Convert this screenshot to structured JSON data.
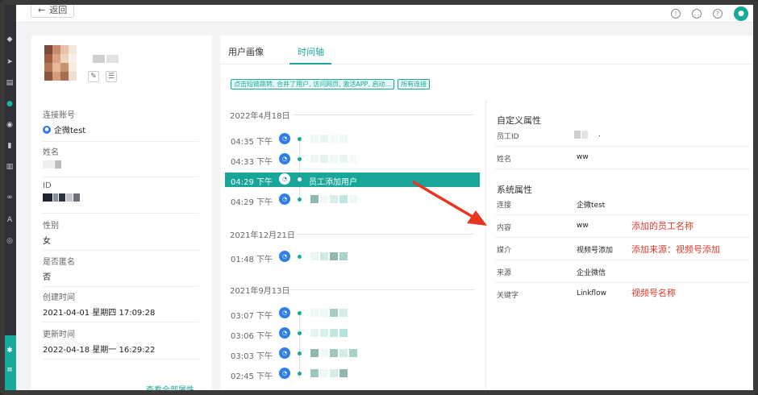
{
  "topbar": {
    "back_label": "返回",
    "back_icon": "arrow-left-icon"
  },
  "profile": {
    "fields": [
      {
        "label": "连接账号",
        "value": "企微test"
      },
      {
        "label": "姓名",
        "value": ""
      },
      {
        "label": "ID",
        "value": ""
      },
      {
        "label": "性别",
        "value": "女"
      },
      {
        "label": "是否匿名",
        "value": "否"
      },
      {
        "label": "创建时间",
        "value": "2021-04-01 星期四 17:09:28"
      },
      {
        "label": "更新时间",
        "value": "2022-04-18 星期一 16:29:22"
      }
    ],
    "more_link": "查看全部属性"
  },
  "tabs": [
    {
      "label": "用户画像"
    },
    {
      "label": "时间轴"
    }
  ],
  "filters": {
    "events_tag": "点击短链跳转, 合并了用户, 访问网页, 激活APP, 启动...",
    "connections_tag": "所有连接"
  },
  "timeline": {
    "groups": [
      {
        "date": "2022年4月18日",
        "items": [
          {
            "time": "04:35 下午",
            "text": ""
          },
          {
            "time": "04:33 下午",
            "text": ""
          },
          {
            "time": "04:29 下午",
            "text": "员工添加用户"
          },
          {
            "time": "04:29 下午",
            "text": ""
          }
        ]
      },
      {
        "date": "2021年12月21日",
        "items": [
          {
            "time": "01:48 下午",
            "text": ""
          }
        ]
      },
      {
        "date": "2021年9月13日",
        "items": [
          {
            "time": "03:07 下午",
            "text": ""
          },
          {
            "time": "03:06 下午",
            "text": ""
          },
          {
            "time": "03:03 下午",
            "text": ""
          },
          {
            "time": "02:45 下午",
            "text": ""
          }
        ]
      }
    ]
  },
  "custom_attrs": {
    "title": "自定义属性",
    "rows": [
      {
        "key": "员工ID",
        "value": "."
      },
      {
        "key": "姓名",
        "value": "ww"
      }
    ]
  },
  "system_attrs": {
    "title": "系统属性",
    "rows": [
      {
        "key": "连接",
        "value": "企微test"
      },
      {
        "key": "内容",
        "value": "ww"
      },
      {
        "key": "媒介",
        "value": "视频号添加"
      },
      {
        "key": "来源",
        "value": "企业微信"
      },
      {
        "key": "关键字",
        "value": "Linkflow"
      }
    ]
  },
  "annotations": {
    "content_note": "添加的员工名称",
    "medium_note": "添加来源：视频号添加",
    "keyword_note": "视频号名称",
    "color": "#e23a2a"
  },
  "colors": {
    "accent": "#19a99a",
    "icon_blue": "#2f7ee6"
  }
}
